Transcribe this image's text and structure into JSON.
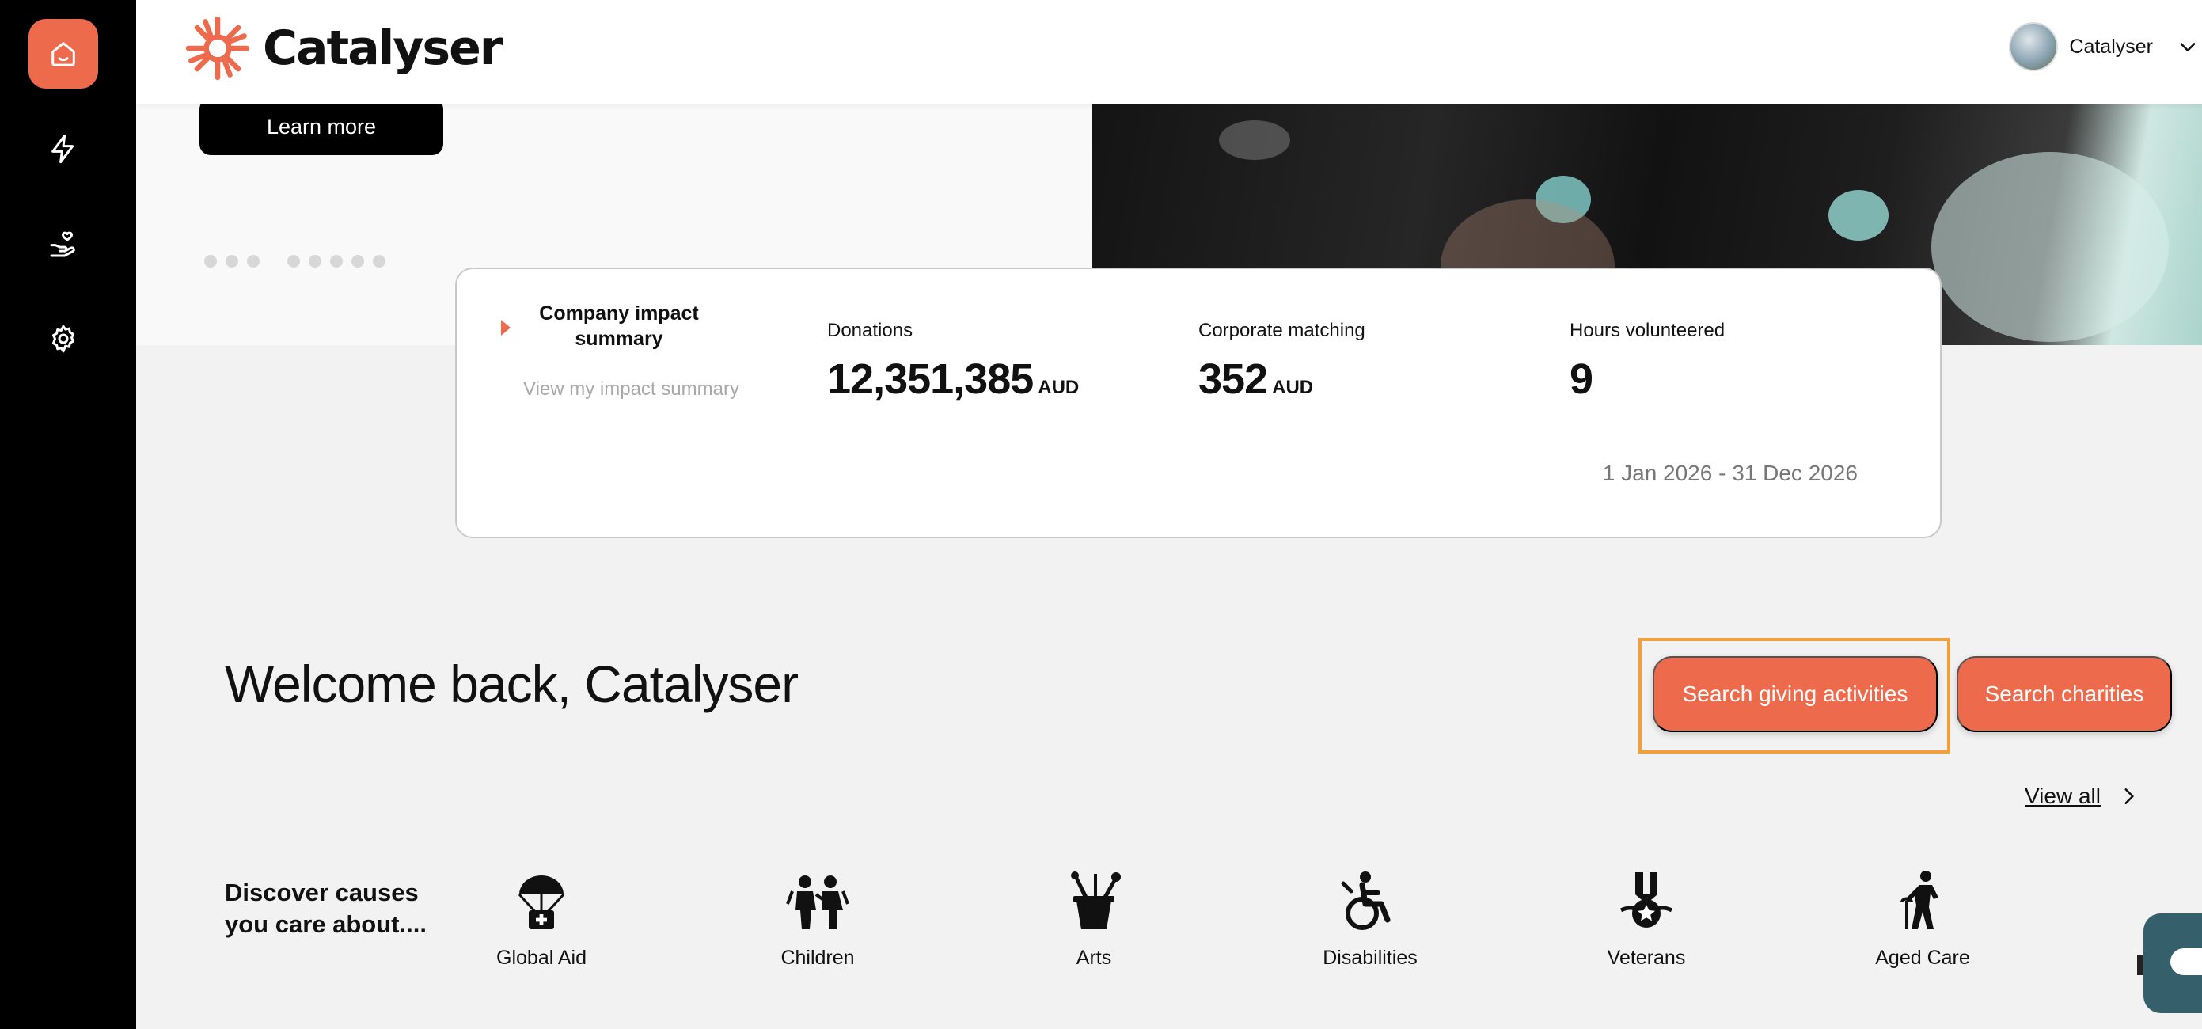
{
  "app": {
    "brand": "Catalyser"
  },
  "colors": {
    "accent": "#ee6a4d",
    "sidebar": "#000000",
    "focus": "#f0a13c",
    "chat": "#355f6b"
  },
  "sidebar": {
    "items": [
      {
        "icon": "home-icon",
        "active": true
      },
      {
        "icon": "lightning-icon",
        "active": false
      },
      {
        "icon": "giving-hand-icon",
        "active": false
      },
      {
        "icon": "gear-icon",
        "active": false
      }
    ]
  },
  "header": {
    "user_name": "Catalyser",
    "menu_icon": "chevron-down-icon"
  },
  "hero": {
    "learn_more_label": "Learn more",
    "carousel_dots": 8
  },
  "impact": {
    "title": "Company impact summary",
    "link": "View my impact summary",
    "stats": [
      {
        "label": "Donations",
        "value": "12,351,385",
        "unit": "AUD"
      },
      {
        "label": "Corporate matching",
        "value": "352",
        "unit": "AUD"
      },
      {
        "label": "Hours volunteered",
        "value": "9",
        "unit": ""
      }
    ],
    "date_range": "1 Jan 2026 - 31 Dec 2026"
  },
  "welcome": {
    "heading": "Welcome back, Catalyser",
    "search_giving_label": "Search giving activities",
    "search_charities_label": "Search charities"
  },
  "causes": {
    "title": "Discover causes you care about....",
    "view_all_label": "View all",
    "items": [
      {
        "label": "Global Aid",
        "icon": "parachute-aid-icon"
      },
      {
        "label": "Children",
        "icon": "children-icon"
      },
      {
        "label": "Arts",
        "icon": "paint-brushes-icon"
      },
      {
        "label": "Disabilities",
        "icon": "wheelchair-icon"
      },
      {
        "label": "Veterans",
        "icon": "medal-icon"
      },
      {
        "label": "Aged Care",
        "icon": "elderly-person-icon"
      }
    ]
  }
}
